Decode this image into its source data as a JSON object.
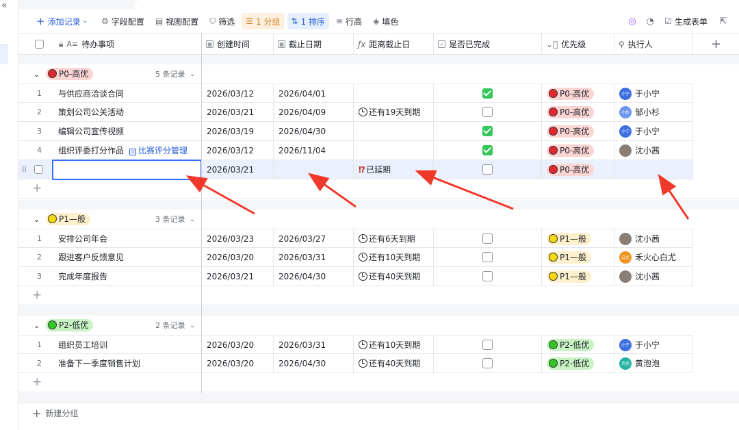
{
  "sidebar": {
    "collapse_glyph": "«"
  },
  "toolbar": {
    "add_record": "添加记录",
    "field_config": "字段配置",
    "view_config": "视图配置",
    "filter": "筛选",
    "group": "1 分组",
    "sort": "1 排序",
    "row_height": "行高",
    "fill_color": "填色",
    "generate_form": "生成表单"
  },
  "columns": [
    {
      "label": "待办事项",
      "icon": "text-field-icon"
    },
    {
      "label": "创建时间",
      "icon": "date-field-icon"
    },
    {
      "label": "截止日期",
      "icon": "date-field-icon"
    },
    {
      "label": "距离截止日",
      "icon": "formula-field-icon"
    },
    {
      "label": "是否已完成",
      "icon": "checkbox-field-icon"
    },
    {
      "label": "优先级",
      "icon": "single-select-field-icon"
    },
    {
      "label": "执行人",
      "icon": "person-field-icon"
    }
  ],
  "groups": [
    {
      "label": "P0-高优",
      "count": "5 条记录",
      "dot": "#e0282e",
      "bg": "#fbd4d4",
      "rows": [
        {
          "num": "1",
          "title": "与供应商洽谈合同",
          "link": "",
          "created": "2026/03/12",
          "due": "2026/04/01",
          "remain": "",
          "clock": false,
          "done": true,
          "priority": "P0-高优",
          "assignee": "于小宁",
          "avatar_text": "小宁",
          "avatar_color": "#3c6fe0"
        },
        {
          "num": "2",
          "title": "策划公司公关活动",
          "link": "",
          "created": "2026/03/21",
          "due": "2026/04/09",
          "remain": "还有19天到期",
          "clock": true,
          "done": false,
          "priority": "P0-高优",
          "assignee": "邹小杉",
          "avatar_text": "小杉",
          "avatar_color": "#6b96f0"
        },
        {
          "num": "3",
          "title": "编辑公司宣传视频",
          "link": "",
          "created": "2026/03/19",
          "due": "2026/04/30",
          "remain": "",
          "clock": false,
          "done": true,
          "priority": "P0-高优",
          "assignee": "于小宁",
          "avatar_text": "小宁",
          "avatar_color": "#3c6fe0"
        },
        {
          "num": "4",
          "title": "组织评委打分作品",
          "link": "比赛评分管理",
          "created": "2026/03/12",
          "due": "2026/11/04",
          "remain": "",
          "clock": false,
          "done": true,
          "priority": "P0-高优",
          "assignee": "沈小茜",
          "avatar_text": "",
          "avatar_color": "#8a7f76"
        },
        {
          "num": "",
          "title": "",
          "link": "",
          "created": "2026/03/21",
          "due": "",
          "remain": "已延期",
          "clock": false,
          "overdue": true,
          "done": false,
          "priority": "P0-高优",
          "assignee": "",
          "avatar_text": "",
          "avatar_color": ""
        }
      ]
    },
    {
      "label": "P1—般",
      "count": "3 条记录",
      "dot": "#f5d90a",
      "bg": "#fdf0cc",
      "rows": [
        {
          "num": "1",
          "title": "安排公司年会",
          "link": "",
          "created": "2026/03/23",
          "due": "2026/03/27",
          "remain": "还有6天到期",
          "clock": true,
          "done": false,
          "priority": "P1—般",
          "assignee": "沈小茜",
          "avatar_text": "",
          "avatar_color": "#8a7f76"
        },
        {
          "num": "2",
          "title": "跟进客户反馈意见",
          "link": "",
          "created": "2026/03/20",
          "due": "2026/03/31",
          "remain": "还有10天到期",
          "clock": true,
          "done": false,
          "priority": "P1—般",
          "assignee": "禾火心白尤",
          "avatar_text": "白尤",
          "avatar_color": "#f0921e"
        },
        {
          "num": "3",
          "title": "完成年度报告",
          "link": "",
          "created": "2026/03/21",
          "due": "2026/04/30",
          "remain": "还有40天到期",
          "clock": true,
          "done": false,
          "priority": "P1—般",
          "assignee": "沈小茜",
          "avatar_text": "",
          "avatar_color": "#8a7f76"
        }
      ]
    },
    {
      "label": "P2-低优",
      "count": "2 条记录",
      "dot": "#34c724",
      "bg": "#c9f2c4",
      "rows": [
        {
          "num": "1",
          "title": "组织员工培训",
          "link": "",
          "created": "2026/03/20",
          "due": "2026/03/31",
          "remain": "还有10天到期",
          "clock": true,
          "done": false,
          "priority": "P2-低优",
          "assignee": "于小宁",
          "avatar_text": "小宁",
          "avatar_color": "#3c6fe0"
        },
        {
          "num": "2",
          "title": "准备下一季度销售计划",
          "link": "",
          "created": "2026/03/20",
          "due": "2026/04/30",
          "remain": "还有40天到期",
          "clock": true,
          "done": false,
          "priority": "P2-低优",
          "assignee": "黄泡泡",
          "avatar_text": "泡泡",
          "avatar_color": "#22b3a1"
        }
      ]
    }
  ],
  "new_group": "新建分组",
  "colors": {
    "accent": "#3370ff",
    "arrow": "#f0392b",
    "overdue": "#c0392b"
  }
}
